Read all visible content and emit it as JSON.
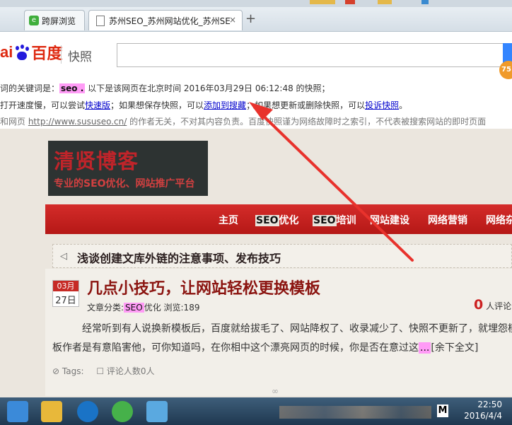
{
  "browser": {
    "tabs": [
      {
        "label": "跨屏浏览",
        "icon": "green-e-icon"
      },
      {
        "label": "苏州SEO_苏州网站优化_苏州SE",
        "icon": "page-icon"
      }
    ],
    "close_symbol": "×",
    "newtab_symbol": "+"
  },
  "baidu": {
    "logo_left": "ai",
    "logo_right": "百度",
    "logo_paw": "du",
    "product": "快照",
    "badge": "75"
  },
  "info": {
    "line1_pre": "词的关键词是：",
    "keyword": "seo .",
    "line1_post": "以下是该网页在北京时间 2016年03月29日 06:12:48 的快照；",
    "line2_a": "打开速度慢，可以尝试",
    "link_fast": "快速版",
    "line2_b": "；如果想保存快照，可以",
    "link_add": "添加到搜藏",
    "line2_c": "；如果想更新或删除快照，可以",
    "link_report": "投诉快照",
    "line2_d": "。",
    "line3_a": "和网页 ",
    "line3_url": "http://www.sususeo.cn/",
    "line3_b": " 的作者无关，不对其内容负责。百度快照谨为网络故障时之索引，不代表被搜索网站的即时页面"
  },
  "site": {
    "blog_title": "清贤博客",
    "blog_subtitle": "专业的SEO优化、网站推广平台",
    "nav": [
      {
        "pre": "",
        "hl": "",
        "post": "主页"
      },
      {
        "pre": "",
        "hl": "SEO",
        "post": "优化"
      },
      {
        "pre": "",
        "hl": "SEO",
        "post": "培训"
      },
      {
        "pre": "",
        "hl": "",
        "post": "网站建设"
      },
      {
        "pre": "",
        "hl": "",
        "post": "网络营销"
      },
      {
        "pre": "",
        "hl": "",
        "post": "网络杂"
      }
    ],
    "notice": "浅谈创建文库外链的注意事项、发布技巧",
    "article": {
      "month": "03月",
      "day": "27日",
      "title": "几点小技巧，让网站轻松更换模板",
      "meta_pre": "文章分类:",
      "meta_hl": "SEO",
      "meta_post": "优化  浏览:189",
      "comment_num": "0",
      "comment_label": "人评论",
      "body_a": "经常听到有人说换新模板后，百度就给拔毛了、网站降权了、收录减少了、快照不更新了，就埋怨模板作者是有意陷害他，可你知道吗，在你相中这个漂亮网页的时候，你是否在意过这",
      "body_hl": "...",
      "body_more": "[余下全文]",
      "tags": "Tags:",
      "comments": "评论人数0人",
      "divider": "∞"
    }
  },
  "taskbar": {
    "clock_time": "22:50",
    "clock_date": "2016/4/4",
    "m_label": "M"
  }
}
